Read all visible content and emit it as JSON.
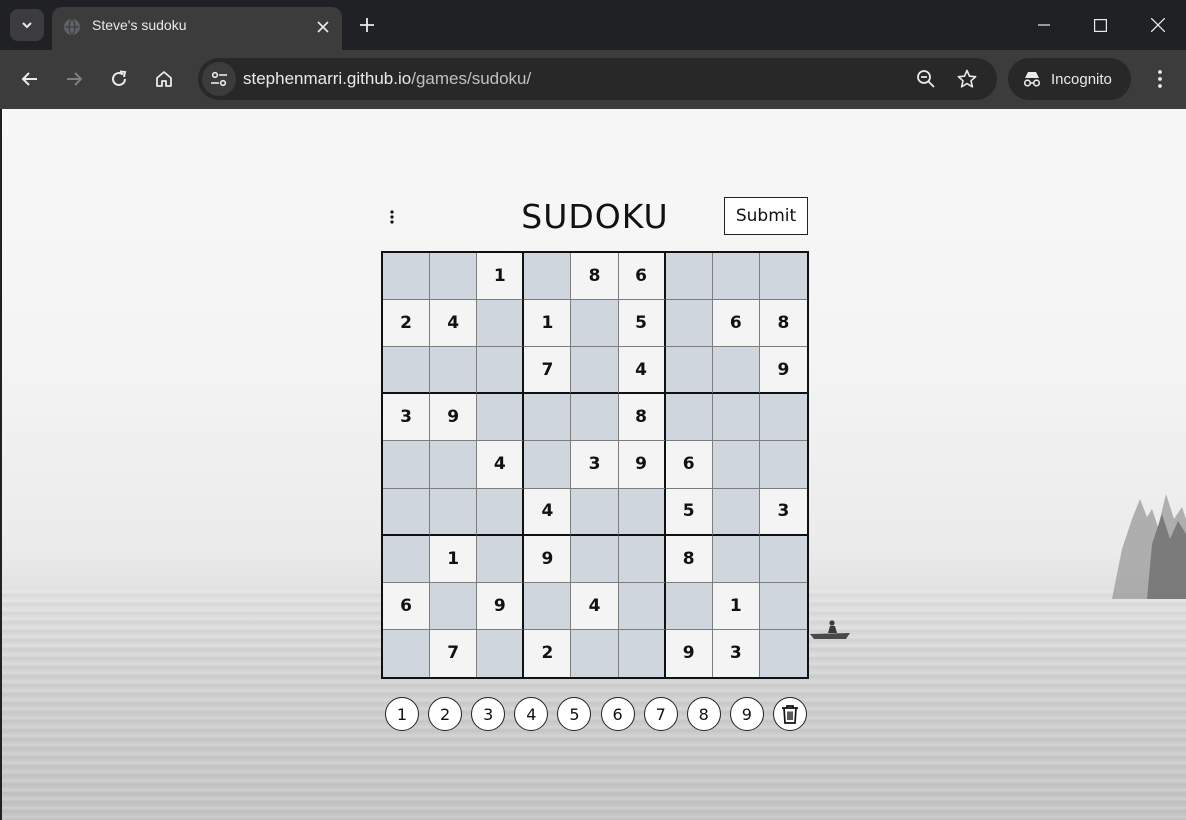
{
  "browser": {
    "tab_title": "Steve's sudoku",
    "url_host": "stephenmarri.github.io",
    "url_path": "/games/sudoku/",
    "incognito_label": "Incognito"
  },
  "game": {
    "title": "SUDOKU",
    "submit_label": "Submit",
    "grid": [
      [
        "",
        "",
        "1",
        "",
        "8",
        "6",
        "",
        "",
        ""
      ],
      [
        "2",
        "4",
        "",
        "1",
        "",
        "5",
        "",
        "6",
        "8"
      ],
      [
        "",
        "",
        "",
        "7",
        "",
        "4",
        "",
        "",
        "9"
      ],
      [
        "3",
        "9",
        "",
        "",
        "",
        "8",
        "",
        "",
        ""
      ],
      [
        "",
        "",
        "4",
        "",
        "3",
        "9",
        "6",
        "",
        ""
      ],
      [
        "",
        "",
        "",
        "4",
        "",
        "",
        "5",
        "",
        "3"
      ],
      [
        "",
        "1",
        "",
        "9",
        "",
        "",
        "8",
        "",
        ""
      ],
      [
        "6",
        "",
        "9",
        "",
        "4",
        "",
        "",
        "1",
        ""
      ],
      [
        "",
        "7",
        "",
        "2",
        "",
        "",
        "9",
        "3",
        ""
      ]
    ],
    "numpad": [
      "1",
      "2",
      "3",
      "4",
      "5",
      "6",
      "7",
      "8",
      "9"
    ],
    "colors": {
      "given_cell": "#f4f4f4",
      "empty_cell": "#d0d6dd"
    }
  }
}
